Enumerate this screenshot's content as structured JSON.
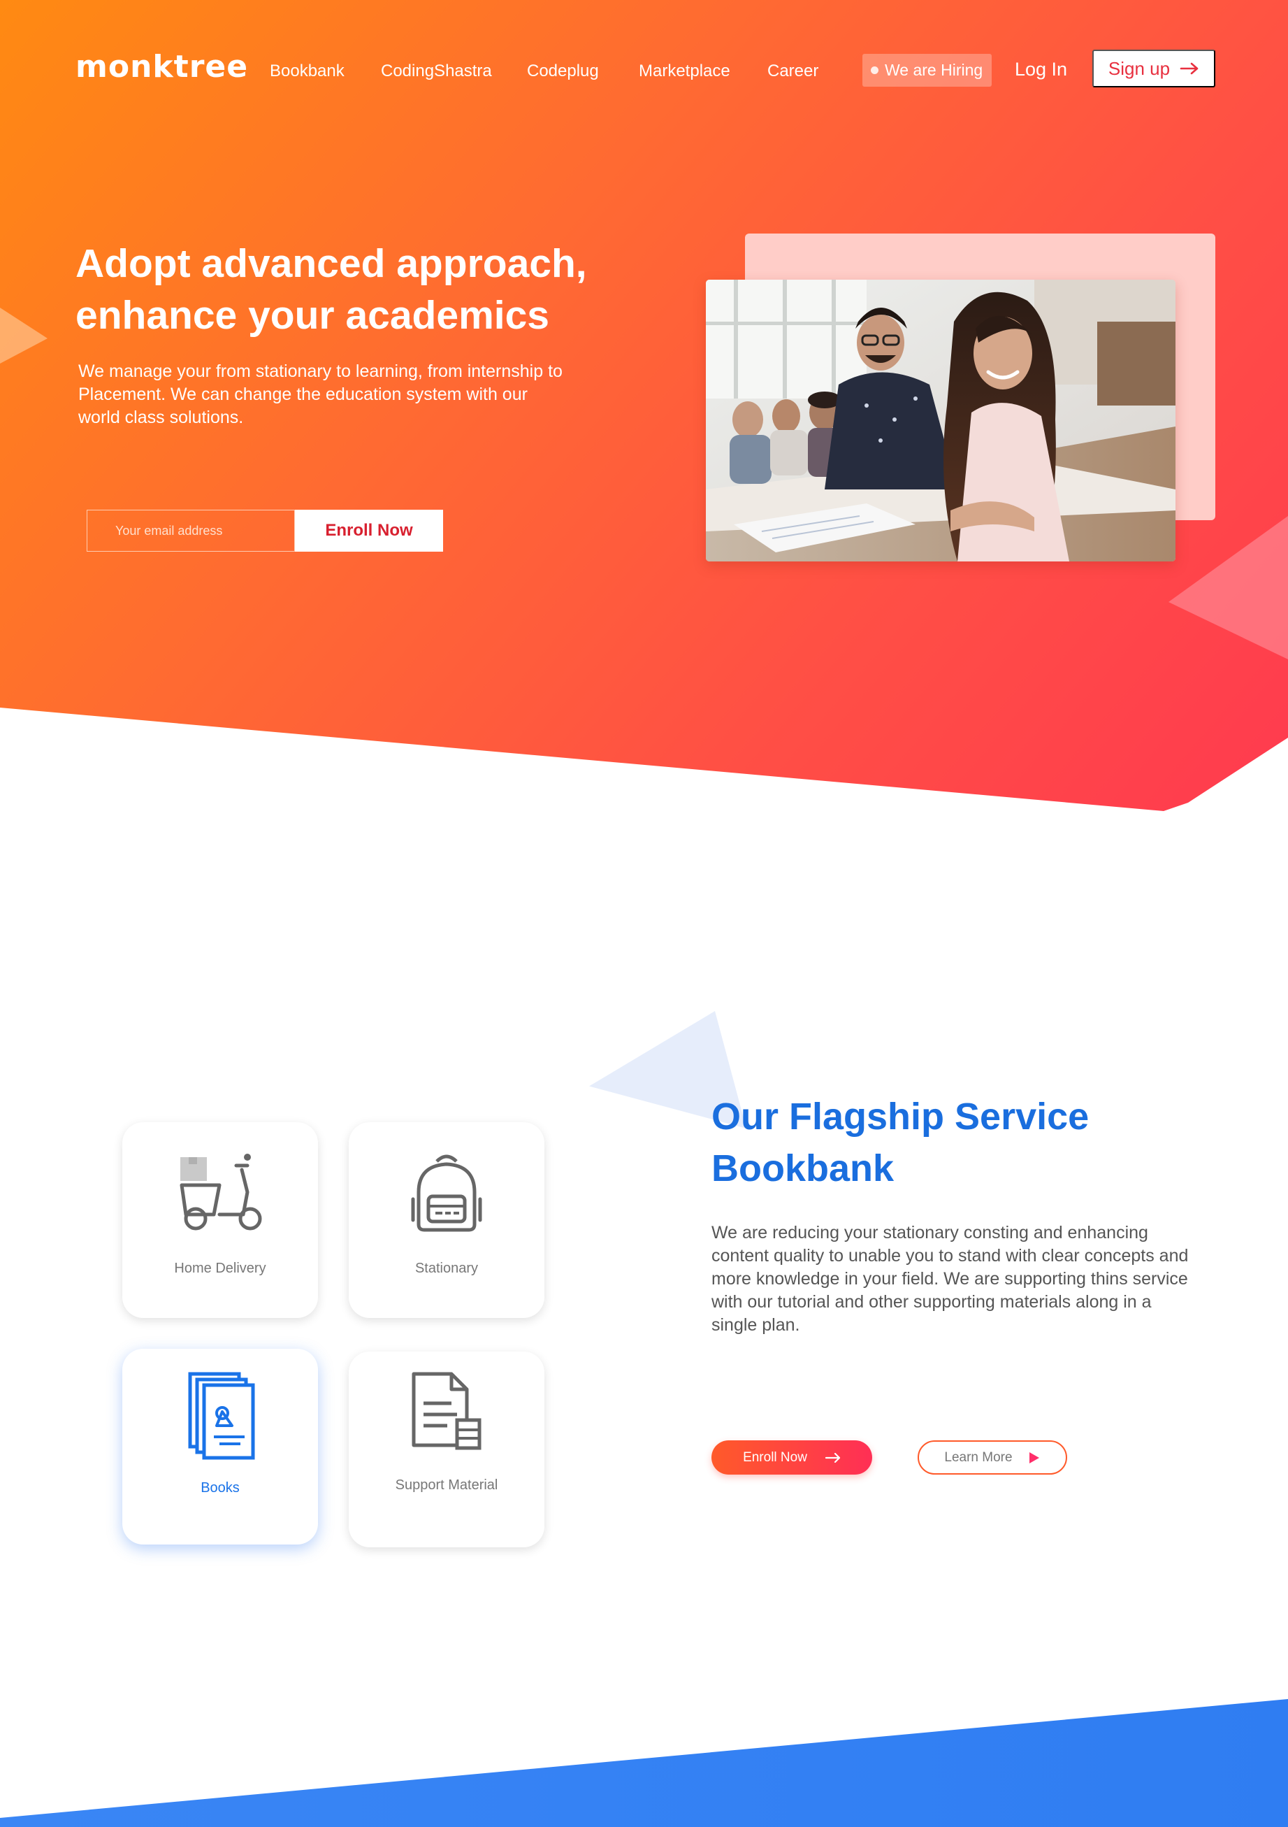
{
  "brand": {
    "logo_text": "monktree"
  },
  "nav": {
    "links": [
      "Bookbank",
      "CodingShastra",
      "Codeplug",
      "Marketplace",
      "Career"
    ],
    "hiring_label": "We are Hiring",
    "login_label": "Log In",
    "signup_label": "Sign up"
  },
  "hero": {
    "title_line1": "Adopt advanced approach,",
    "title_line2": "enhance your academics",
    "description": "We manage your from stationary to learning, from  internship to Placement. We  can change  the  education system with our world class solutions.",
    "email_placeholder": "Your email address",
    "enroll_label": "Enroll Now"
  },
  "services": {
    "cards": [
      {
        "label": "Home Delivery",
        "icon": "scooter-icon",
        "active": false
      },
      {
        "label": "Stationary",
        "icon": "backpack-icon",
        "active": false
      },
      {
        "label": "Books",
        "icon": "books-icon",
        "active": true
      },
      {
        "label": "Support Material",
        "icon": "document-icon",
        "active": false
      }
    ]
  },
  "flagship": {
    "title_line1": "Our Flagship Service",
    "title_line2": "Bookbank",
    "description": "We are reducing your stationary consting and enhancing content quality to unable you to stand with clear concepts and more knowledge in your field. We are supporting thins service with our tutorial and other supporting materials along in a single plan.",
    "enroll_label": "Enroll Now",
    "learn_label": "Learn More"
  },
  "colors": {
    "hero_gradient_start": "#ff8a12",
    "hero_gradient_end": "#ff3a4f",
    "brand_blue": "#1a6ede",
    "accent_red": "#e8303f",
    "footer_blue": "#3a86f5"
  }
}
